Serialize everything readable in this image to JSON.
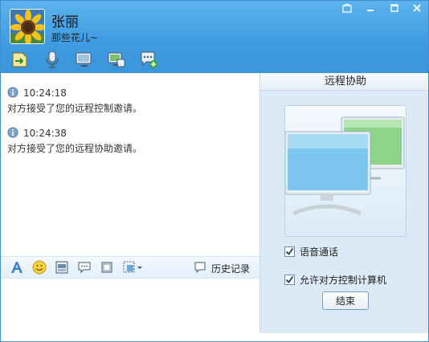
{
  "contact": {
    "name": "张丽",
    "signature": "那些花儿~"
  },
  "window_controls": [
    "skin-icon",
    "minimize-icon",
    "maximize-icon",
    "close-icon"
  ],
  "toolbar": {
    "items": [
      {
        "icon": "file-transfer-icon"
      },
      {
        "icon": "microphone-icon"
      },
      {
        "icon": "video-monitor-icon"
      },
      {
        "icon": "remote-desktop-icon"
      },
      {
        "icon": "more-apps-icon"
      }
    ]
  },
  "messages": [
    {
      "time": "10:24:18",
      "text": "对方接受了您的远程控制邀请。"
    },
    {
      "time": "10:24:38",
      "text": "对方接受了您的远程协助邀请。"
    }
  ],
  "input_toolbar": {
    "icons": [
      "font-icon",
      "emoji-icon",
      "screenshot-icon",
      "bubble-icon",
      "window-icon",
      "send-picture-icon"
    ],
    "history_label": "历史记录"
  },
  "remote_panel": {
    "title": "远程协助",
    "voice_label": "语音通话",
    "voice_checked": true,
    "control_label": "允许对方控制计算机",
    "control_checked": true,
    "end_button": "结束"
  },
  "colors": {
    "header_blue": "#3e9be0",
    "panel_bg": "#dbeaf6",
    "monitor_green": "#8fd38a",
    "monitor_blue": "#7cc6ef"
  }
}
